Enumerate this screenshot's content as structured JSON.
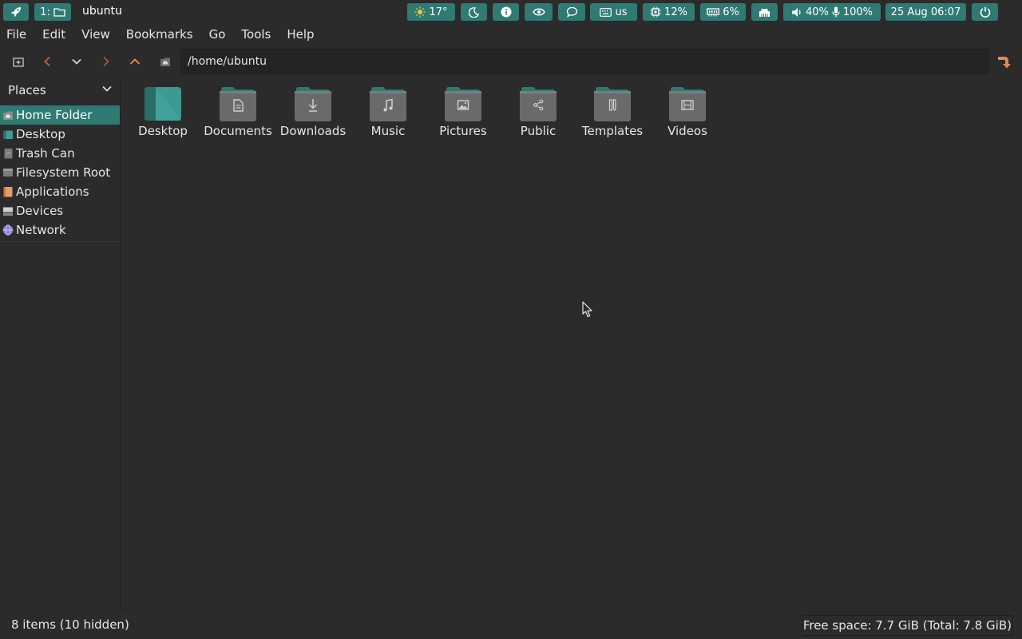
{
  "panel": {
    "workspace": "1:",
    "window_title": "ubuntu",
    "weather": "17°",
    "keyboard": "us",
    "cpu": "12%",
    "memory": "6%",
    "volume": "40%",
    "mic": "100%",
    "datetime": "25 Aug 06:07",
    "accent": "#2f7a73"
  },
  "menubar": {
    "items": [
      "File",
      "Edit",
      "View",
      "Bookmarks",
      "Go",
      "Tools",
      "Help"
    ]
  },
  "toolbar": {
    "path": "/home/ubuntu"
  },
  "sidebar": {
    "header": "Places",
    "items": [
      {
        "label": "Home Folder",
        "icon": "home-folder-icon",
        "active": true
      },
      {
        "label": "Desktop",
        "icon": "desktop-icon"
      },
      {
        "label": "Trash Can",
        "icon": "trash-icon"
      },
      {
        "label": "Filesystem Root",
        "icon": "drive-icon"
      },
      {
        "label": "Applications",
        "icon": "applications-icon"
      },
      {
        "label": "Devices",
        "icon": "devices-icon"
      },
      {
        "label": "Network",
        "icon": "network-icon"
      }
    ]
  },
  "folders": [
    {
      "name": "Desktop",
      "icon": "desktop-folder-icon"
    },
    {
      "name": "Documents",
      "icon": "documents-folder-icon"
    },
    {
      "name": "Downloads",
      "icon": "downloads-folder-icon"
    },
    {
      "name": "Music",
      "icon": "music-folder-icon"
    },
    {
      "name": "Pictures",
      "icon": "pictures-folder-icon"
    },
    {
      "name": "Public",
      "icon": "public-folder-icon"
    },
    {
      "name": "Templates",
      "icon": "templates-folder-icon"
    },
    {
      "name": "Videos",
      "icon": "videos-folder-icon"
    }
  ],
  "status": {
    "items": "8 items (10 hidden)",
    "free_space": "Free space: 7.7 GiB (Total: 7.8 GiB)"
  }
}
